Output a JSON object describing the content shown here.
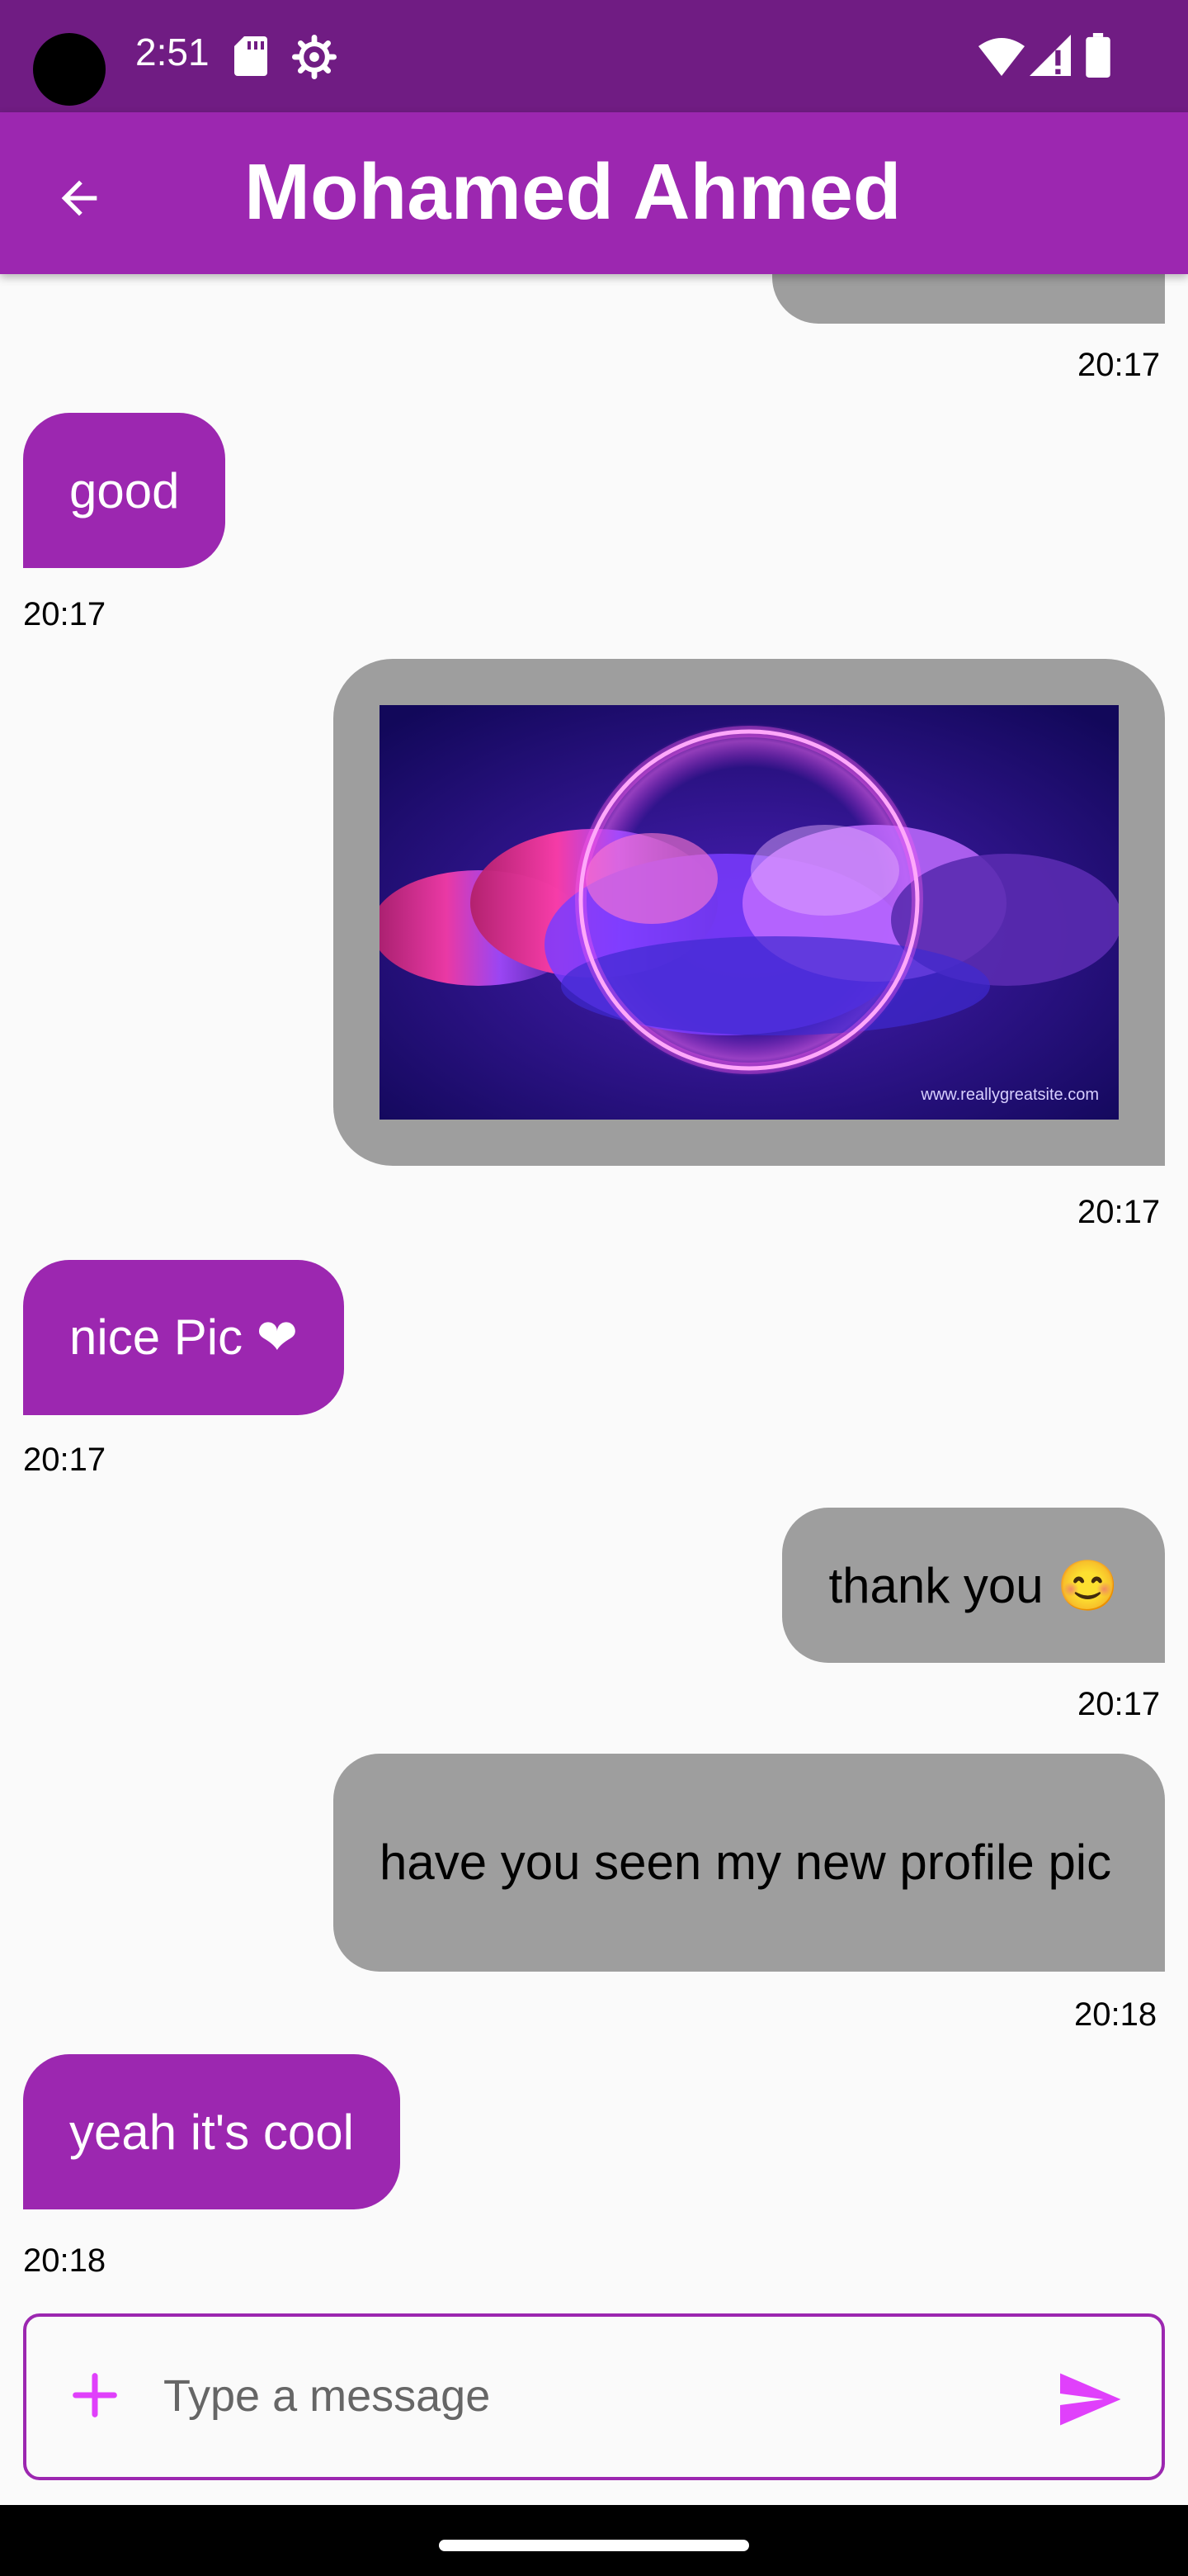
{
  "status_bar": {
    "time": "2:51"
  },
  "header": {
    "title": "Mohamed Ahmed"
  },
  "messages": [
    {
      "direction": "outgoing",
      "type": "text",
      "text": "",
      "time": "20:17"
    },
    {
      "direction": "incoming",
      "type": "text",
      "text": "good",
      "time": "20:17"
    },
    {
      "direction": "outgoing",
      "type": "image",
      "watermark": "www.reallygreatsite.com",
      "time": "20:17"
    },
    {
      "direction": "incoming",
      "type": "text",
      "text": "nice Pic ❤",
      "time": "20:17"
    },
    {
      "direction": "outgoing",
      "type": "text",
      "text": "thank you 😊",
      "time": "20:17"
    },
    {
      "direction": "outgoing",
      "type": "text",
      "text": "have you seen my new profile pic",
      "time": "20:18"
    },
    {
      "direction": "incoming",
      "type": "text",
      "text": "yeah it's cool",
      "time": "20:18"
    }
  ],
  "composer": {
    "placeholder": "Type a message"
  },
  "colors": {
    "status_bar": "#701c83",
    "app_bar": "#9c27b0",
    "incoming_bubble": "#9c27b0",
    "outgoing_bubble": "#9e9e9e",
    "accent": "#e040fb"
  },
  "icons": [
    "sd-card-icon",
    "settings-gear-icon",
    "wifi-icon",
    "signal-icon",
    "battery-icon",
    "back-arrow-icon",
    "add-icon",
    "send-icon"
  ]
}
